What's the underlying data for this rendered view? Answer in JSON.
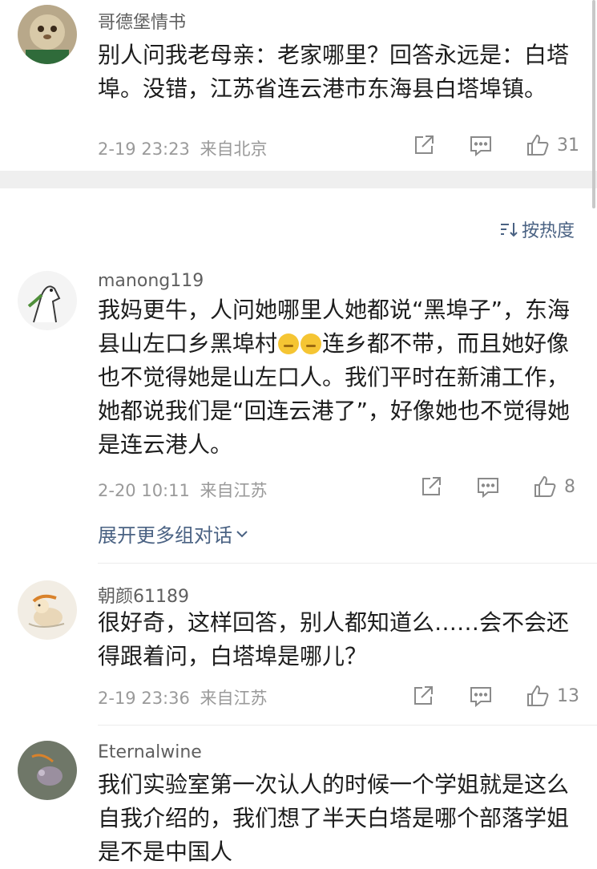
{
  "comments": [
    {
      "user": "哥德堡情书",
      "text": "别人问我老母亲：老家哪里？回答永远是：白塔埠。没错，江苏省连云港市东海县白塔埠镇。",
      "time": "2-19 23:23",
      "location": "来自北京",
      "likes": "31"
    },
    {
      "user": "manong119",
      "text_part1": "我妈更牛，人问她哪里人她都说“黑埠子”，东海县山左口乡黑埠村",
      "text_part2": "连乡都不带，而且她好像也不觉得她是山左口人。我们平时在新浦工作，她都说我们是“回连云港了”，好像她也不觉得她是连云港人。",
      "time": "2-20 10:11",
      "location": "来自江苏",
      "likes": "8"
    },
    {
      "user": "朝颜61189",
      "text": "很好奇，这样回答，别人都知道么……会不会还得跟着问，白塔埠是哪儿？",
      "time": "2-19 23:36",
      "location": "来自江苏",
      "likes": "13"
    },
    {
      "user": "Eternalwine",
      "text": "我们实验室第一次认人的时候一个学姐就是这么自我介绍的，我们想了半天白塔是哪个部落学姐是不是中国人"
    }
  ],
  "sort_label": "按热度",
  "expand_label": "展开更多组对话",
  "icons": {
    "share": "share-icon",
    "comment": "comment-icon",
    "like": "thumbs-up-icon",
    "sort": "sort-icon",
    "chevron": "chevron-down-icon"
  }
}
